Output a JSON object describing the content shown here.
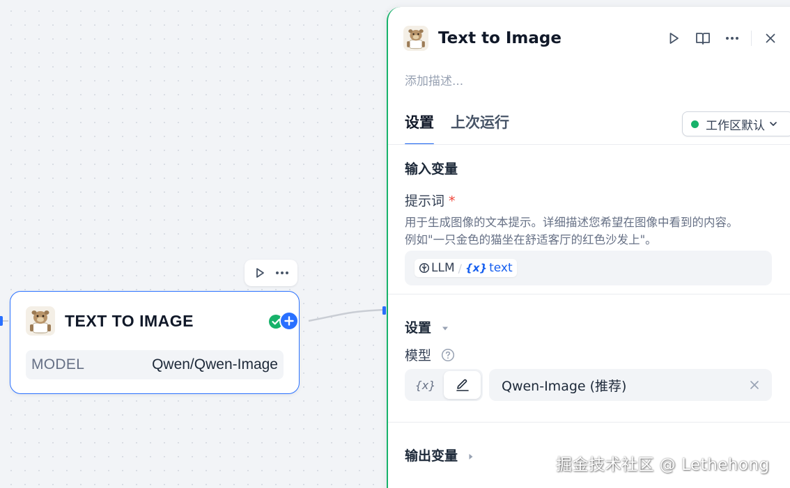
{
  "canvas": {
    "node": {
      "title": "TEXT TO IMAGE",
      "model_key": "MODEL",
      "model_value": "Qwen/Qwen-Image",
      "status": "success",
      "colors": {
        "accent": "#2970ff",
        "success": "#17b26a"
      }
    },
    "toolbar": {
      "run_icon": "play-icon",
      "more_icon": "more-icon"
    }
  },
  "panel": {
    "title": "Text to Image",
    "description_placeholder": "添加描述...",
    "actions": [
      "play-icon",
      "book-icon",
      "more-icon",
      "close-icon"
    ],
    "tabs": [
      {
        "label": "设置",
        "active": true
      },
      {
        "label": "上次运行",
        "active": false
      }
    ],
    "workspace_button": "工作区默认",
    "input_section": {
      "title": "输入变量",
      "field_label": "提示词",
      "required_mark": "*",
      "help_line1": "用于生成图像的文本提示。详细描述您希望在图像中看到的内容。",
      "help_line2": "例如\"一只金色的猫坐在舒适客厅的红色沙发上\"。",
      "chip_node": "LLM",
      "chip_separator": "/",
      "chip_var_icon": "{x}",
      "chip_var": "text"
    },
    "settings_section": {
      "title": "设置",
      "model_label": "模型",
      "toggle_var_label": "{x}",
      "model_value": "Qwen-Image (推荐)"
    },
    "output_section": {
      "title": "输出变量"
    }
  },
  "watermark": "掘金技术社区 @ Lethehong"
}
